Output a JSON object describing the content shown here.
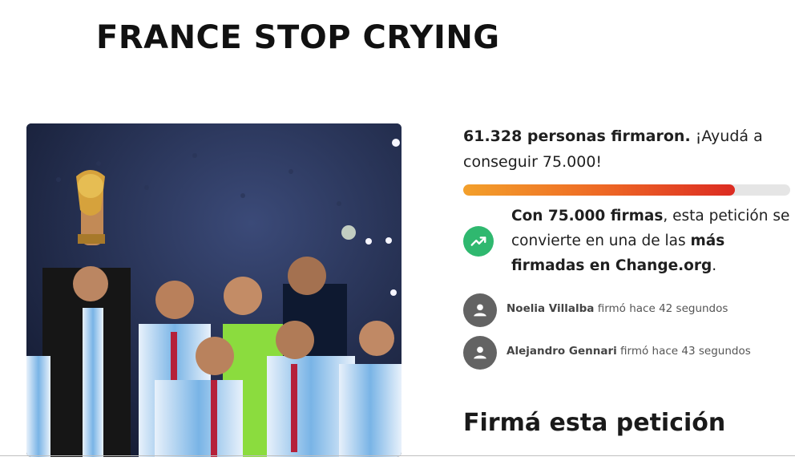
{
  "page": {
    "title": "FRANCE STOP CRYING"
  },
  "image": {
    "icon": "team-celebration-photo"
  },
  "petition": {
    "signed_count": "61.328 personas firmaron.",
    "help_text": " ¡Ayudá a conseguir 75.000!",
    "progress_fraction": 0.83,
    "milestone": {
      "icon": "trending-up-icon",
      "bold_start": "Con 75.000 firmas",
      "middle": ", esta petición se convierte en una de las ",
      "bold_end": "más firmadas en Change.org",
      "end": "."
    },
    "recent_signers": [
      {
        "name": "Noelia Villalba",
        "action": " firmó hace 42 segundos",
        "icon": "user-avatar-icon"
      },
      {
        "name": "Alejandro Gennari",
        "action": " firmó hace 43 segundos",
        "icon": "user-avatar-icon"
      }
    ],
    "sign_heading": "Firmá esta petición"
  },
  "colors": {
    "progress_start": "#f3a02b",
    "progress_end": "#dc2b22",
    "progress_track": "#e5e5e5",
    "trend_icon_bg": "#2fb86f",
    "avatar_bg": "#636363"
  }
}
